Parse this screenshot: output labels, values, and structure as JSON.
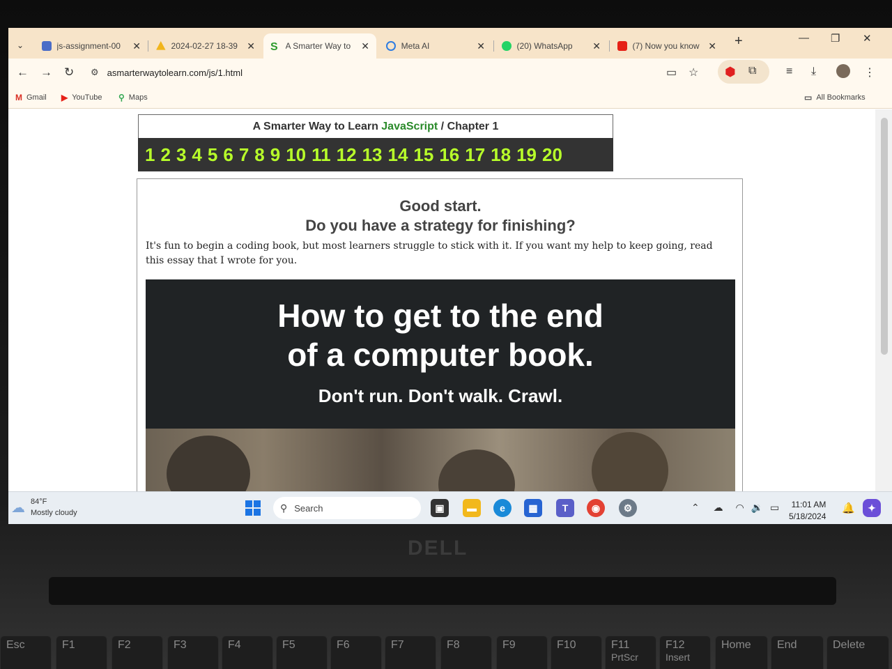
{
  "browser": {
    "tabs": [
      {
        "title": "js-assignment-00",
        "favicon_color": "#4a6cc7"
      },
      {
        "title": "2024-02-27 18-39",
        "favicon_color": "#f1b51c"
      },
      {
        "title": "A Smarter Way to",
        "favicon_color": "#2e9b2e",
        "favicon_letter": "S",
        "active": true
      },
      {
        "title": "Meta AI",
        "favicon_color": "#2f7de1"
      },
      {
        "title": "(20) WhatsApp",
        "favicon_color": "#25d366"
      },
      {
        "title": "(7) Now you know",
        "favicon_color": "#e62117"
      }
    ],
    "url": "asmarterwaytolearn.com/js/1.html",
    "bookmarks": [
      {
        "label": "Gmail",
        "icon": "gmail-icon"
      },
      {
        "label": "YouTube",
        "icon": "youtube-icon"
      },
      {
        "label": "Maps",
        "icon": "maps-icon"
      }
    ],
    "all_bookmarks_label": "All Bookmarks"
  },
  "page": {
    "header_prefix": "A Smarter Way to Learn ",
    "header_js": "JavaScript",
    "header_sep": " / ",
    "header_chapter": "Chapter 1",
    "chapters": [
      "1",
      "2",
      "3",
      "4",
      "5",
      "6",
      "7",
      "8",
      "9",
      "10",
      "11",
      "12",
      "13",
      "14",
      "15",
      "16",
      "17",
      "18",
      "19",
      "20"
    ],
    "good_start": "Good start.",
    "strategy": "Do you have a strategy for finishing?",
    "intro": "It's fun to begin a coding book, but most learners struggle to stick with it. If you want my help to keep going, read this essay that I wrote for you.",
    "banner_line1": "How to get to the end",
    "banner_line2": "of a computer book.",
    "banner_sub": "Don't run. Don't walk. Crawl."
  },
  "taskbar": {
    "weather_temp": "84°F",
    "weather_desc": "Mostly cloudy",
    "search_placeholder": "Search",
    "time": "11:01 AM",
    "date": "5/18/2024"
  },
  "laptop": {
    "brand": "DELL",
    "keys": [
      "Esc",
      "F1",
      "F2",
      "F3",
      "F4",
      "F5",
      "F6",
      "F7",
      "F8",
      "F9",
      "F10",
      "F11",
      "F12",
      "Home",
      "End",
      "Delete"
    ],
    "key_sublabels": {
      "F11": "PrtScr",
      "F12": "Insert"
    }
  }
}
